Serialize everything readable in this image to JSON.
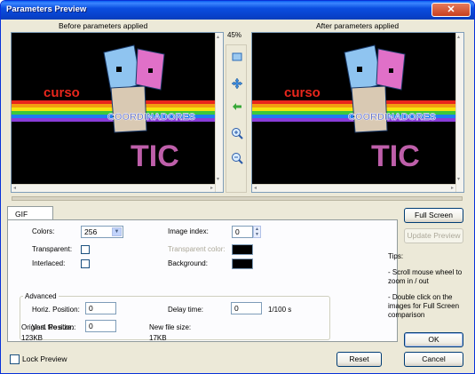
{
  "window": {
    "title": "Parameters Preview",
    "close_label": "✕"
  },
  "preview": {
    "before_label": "Before parameters applied",
    "after_label": "After parameters applied",
    "zoom": "45%",
    "image_text_top": "curso",
    "image_text_middle": "COORDINADORES",
    "image_text_bottom": "TIC"
  },
  "tabs": [
    {
      "label": "GIF"
    }
  ],
  "gif": {
    "colors_label": "Colors:",
    "colors_value": "256",
    "transparent_label": "Transparent:",
    "interlaced_label": "Interlaced:",
    "image_index_label": "Image index:",
    "image_index_value": "0",
    "transparent_color_label": "Transparent color:",
    "background_label": "Background:",
    "advanced_title": "Advanced",
    "horiz_label": "Horiz. Position:",
    "horiz_value": "0",
    "vert_label": "Vert. Position:",
    "vert_value": "0",
    "delay_label": "Delay time:",
    "delay_value": "0",
    "delay_unit": "1/100 s",
    "orig_size_label": "Original file size:",
    "orig_size_value": "123KB",
    "new_size_label": "New file size:",
    "new_size_value": "17KB"
  },
  "buttons": {
    "full_screen": "Full Screen",
    "update_preview": "Update Preview",
    "ok": "OK",
    "cancel": "Cancel",
    "reset": "Reset"
  },
  "lock_preview_label": "Lock Preview",
  "tips": {
    "title": "Tips:",
    "tip1": "- Scroll mouse wheel to zoom in / out",
    "tip2": "- Double click on the images for Full Screen comparison"
  },
  "colors": {
    "title_blue": "#0a4ee0",
    "dialog_bg": "#ece9d8",
    "curso_red": "#e8261c",
    "tic_pink": "#e070c8"
  },
  "icons": [
    "fit-window-icon",
    "move-icon",
    "back-arrow-icon",
    "zoom-in-icon",
    "zoom-out-icon",
    "close-icon"
  ]
}
